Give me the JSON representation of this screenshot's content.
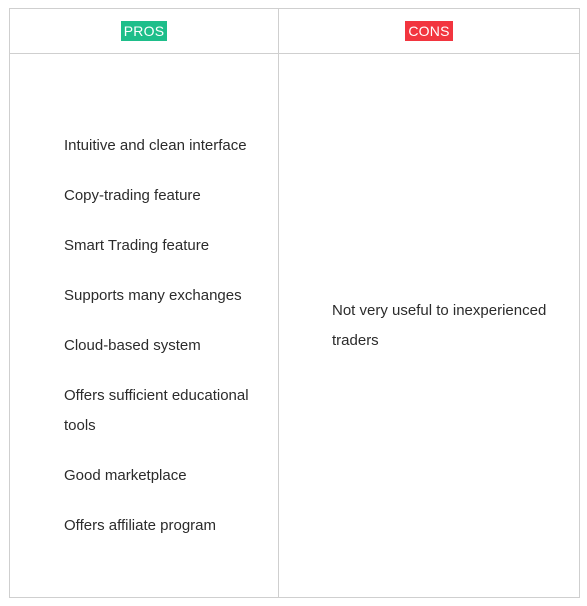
{
  "header": {
    "pros_label": "PROS",
    "cons_label": "CONS"
  },
  "colors": {
    "pros_badge": "#1ebe8a",
    "cons_badge": "#f2353f",
    "border": "#cfcfcf",
    "text": "#2b2b2b"
  },
  "pros": {
    "items": [
      "Intuitive and clean interface",
      "Copy-trading feature",
      "Smart Trading feature",
      "Supports many exchanges",
      "Cloud-based system",
      "Offers sufficient educational tools",
      "Good marketplace",
      "Offers affiliate program"
    ]
  },
  "cons": {
    "items": [
      "Not very useful to inexperienced traders"
    ]
  }
}
